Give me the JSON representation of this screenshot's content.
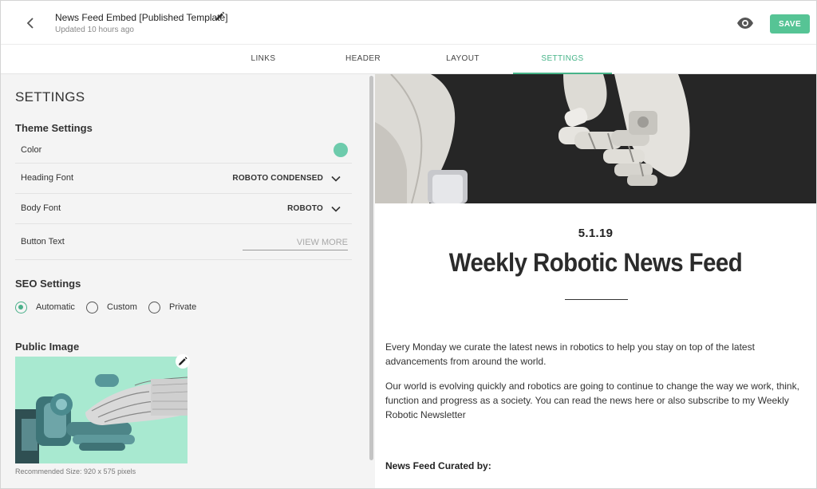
{
  "header": {
    "title": "News Feed Embed [Published Template]",
    "subtitle": "Updated 10 hours ago",
    "save_label": "SAVE",
    "back_icon": "chevron-left-icon",
    "edit_icon": "pencil-icon",
    "preview_icon": "eye-icon"
  },
  "tabs": [
    {
      "label": "LINKS"
    },
    {
      "label": "HEADER"
    },
    {
      "label": "LAYOUT"
    },
    {
      "label": "SETTINGS",
      "active": true
    }
  ],
  "settings": {
    "title": "SETTINGS",
    "theme": {
      "heading": "Theme Settings",
      "color_label": "Color",
      "color_value": "#6dcbac",
      "heading_font_label": "Heading Font",
      "heading_font_value": "ROBOTO CONDENSED",
      "body_font_label": "Body Font",
      "body_font_value": "ROBOTO",
      "button_text_label": "Button Text",
      "button_text_placeholder": "VIEW MORE"
    },
    "seo": {
      "heading": "SEO Settings",
      "options": [
        {
          "label": "Automatic",
          "selected": true
        },
        {
          "label": "Custom",
          "selected": false
        },
        {
          "label": "Private",
          "selected": false
        }
      ]
    },
    "public_image": {
      "heading": "Public Image",
      "recommended": "Recommended Size: 920 x 575 pixels"
    }
  },
  "preview": {
    "date": "5.1.19",
    "title": "Weekly Robotic News Feed",
    "paragraphs": [
      "Every Monday we curate the latest news in robotics to help you stay on top of the latest advancements from around the world.",
      "Our world is evolving quickly and robotics are going to continue to change the way we work, think, function and progress as a society. You can read the news here or also subscribe to my Weekly Robotic Newsletter"
    ],
    "curated_by": "News Feed Curated by:"
  },
  "colors": {
    "accent": "#56c495",
    "tab_active": "#47b489",
    "panel_bg": "#f4f4f4"
  }
}
